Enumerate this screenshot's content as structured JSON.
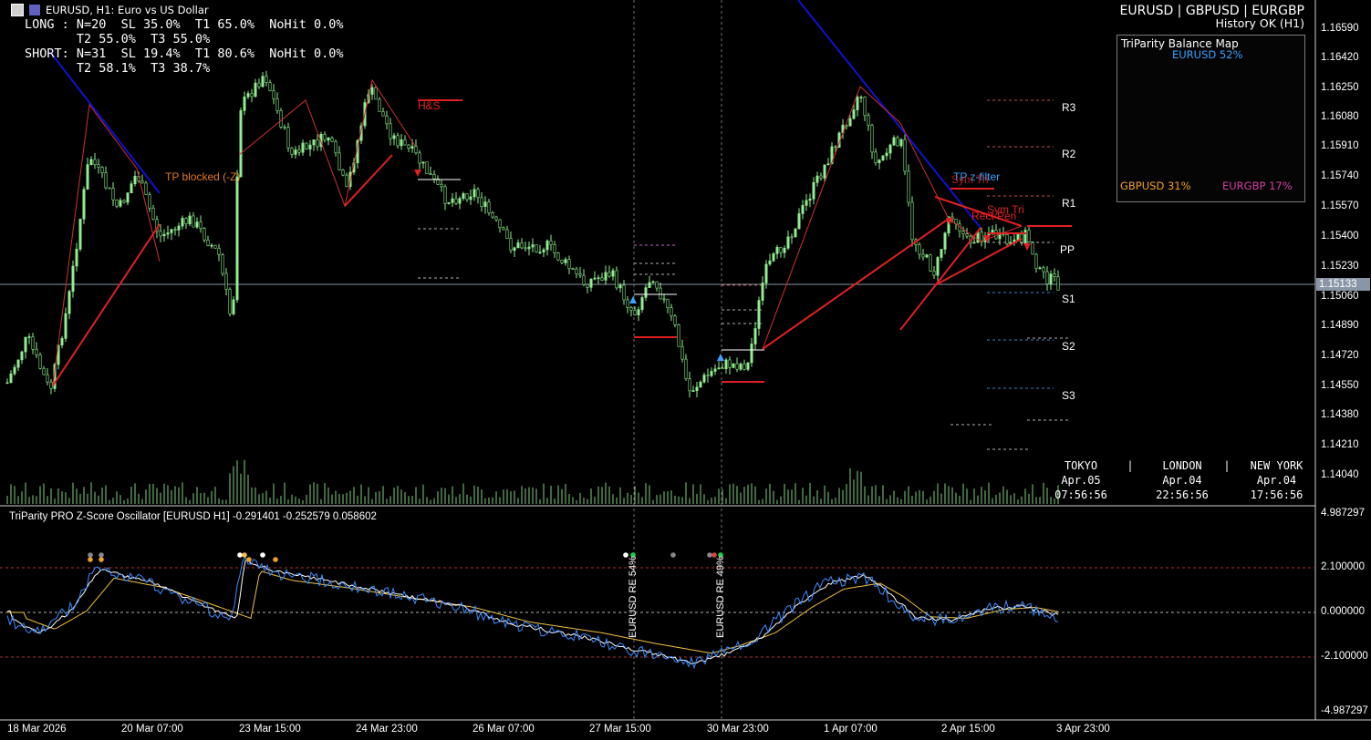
{
  "window": {
    "title": "EURUSD, H1:  Euro vs US Dollar"
  },
  "stats": {
    "long_line1": "LONG : N=20  SL 35.0%  T1 65.0%  NoHit 0.0%",
    "long_line2": "       T2 55.0%  T3 55.0%",
    "short_line1": "SHORT: N=31  SL 19.4%  T1 80.6%  NoHit 0.0%",
    "short_line2": "       T2 58.1%  T3 38.7%"
  },
  "header_right": {
    "pairs": "EURUSD | GBPUSD | EURGBP",
    "history": "History OK (H1)"
  },
  "price_axis": {
    "labels": [
      "1.16590",
      "1.16420",
      "1.16250",
      "1.16080",
      "1.15910",
      "1.15740",
      "1.15570",
      "1.15400",
      "1.15230",
      "1.15060",
      "1.14890",
      "1.14720",
      "1.14550",
      "1.14380",
      "1.14210",
      "1.14040"
    ],
    "current_price": "1.15133",
    "current_color": "#8a96a8"
  },
  "pivots": {
    "r3": "R3",
    "r2": "R2",
    "r1": "R1",
    "pp": "PP",
    "s1": "S1",
    "s2": "S2",
    "s3": "S3"
  },
  "annotations": {
    "tp_blocked": "TP blocked (-Z)",
    "hs": "H&S",
    "tp_zfilter": "TP z-filter",
    "sym_tri_1": "Sym Tri",
    "rect_pen": "Rect Pen",
    "sym_tri_2": "Sym Tri"
  },
  "balance_map": {
    "title": "TriParity Balance Map",
    "eurusd": "EURUSD 52%",
    "gbpusd": "GBPUSD 31%",
    "eurgbp": "EURGBP 17%",
    "colors": {
      "eurusd": "#3aa0ff",
      "gbpusd": "#f0a020",
      "eurgbp": "#d040a0",
      "frame": "#30c8e0"
    }
  },
  "sessions": [
    {
      "name": "TOKYO",
      "date": "Apr.05",
      "time": "07:56:56"
    },
    {
      "name": "LONDON",
      "date": "Apr.04",
      "time": "22:56:56"
    },
    {
      "name": "NEW YORK",
      "date": "Apr.04",
      "time": "17:56:56"
    }
  ],
  "oscillator": {
    "title": "TriParity PRO Z-Score Oscillator [EURUSD H1] -0.291401 -0.252579 0.058602",
    "axis_labels": [
      "4.987297",
      "2.100000",
      "0.000000",
      "-2.100000",
      "-4.987297"
    ],
    "re_label_1": "EURUSD RE 54%",
    "re_label_2": "EURUSD RE 49%"
  },
  "time_axis": [
    "18 Mar 2026",
    "20 Mar 07:00",
    "23 Mar 15:00",
    "24 Mar 23:00",
    "26 Mar 07:00",
    "27 Mar 15:00",
    "30 Mar 23:00",
    "1 Apr 07:00",
    "2 Apr 15:00",
    "3 Apr 23:00"
  ],
  "colors": {
    "candle": "#90ee90",
    "short_line": "#e02020",
    "trend_line": "#1010d0",
    "grid_dash": "#8a8a8a",
    "osc_blue": "#3b8bff",
    "osc_white": "#ffffff",
    "osc_yellow": "#f0c040"
  }
}
